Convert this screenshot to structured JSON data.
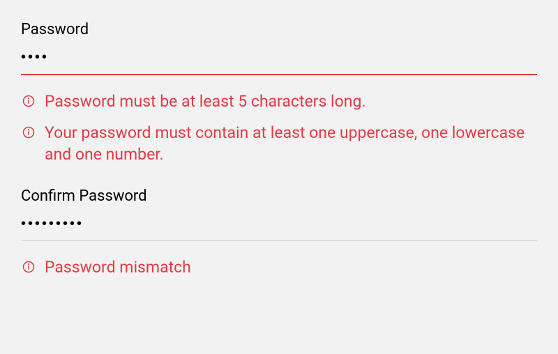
{
  "colors": {
    "error": "#e53946",
    "text": "#000000",
    "bg": "#f2f2f2",
    "neutral_border": "#cfcfcf"
  },
  "fields": {
    "password": {
      "label": "Password",
      "value": "••••",
      "has_error": true,
      "errors": [
        "Password must be at least 5 characters long.",
        "Your password must contain at least one uppercase, one lowercase and one number."
      ]
    },
    "confirm_password": {
      "label": "Confirm Password",
      "value": "•••••••••",
      "has_error": false,
      "errors": [
        "Password mismatch"
      ]
    }
  }
}
